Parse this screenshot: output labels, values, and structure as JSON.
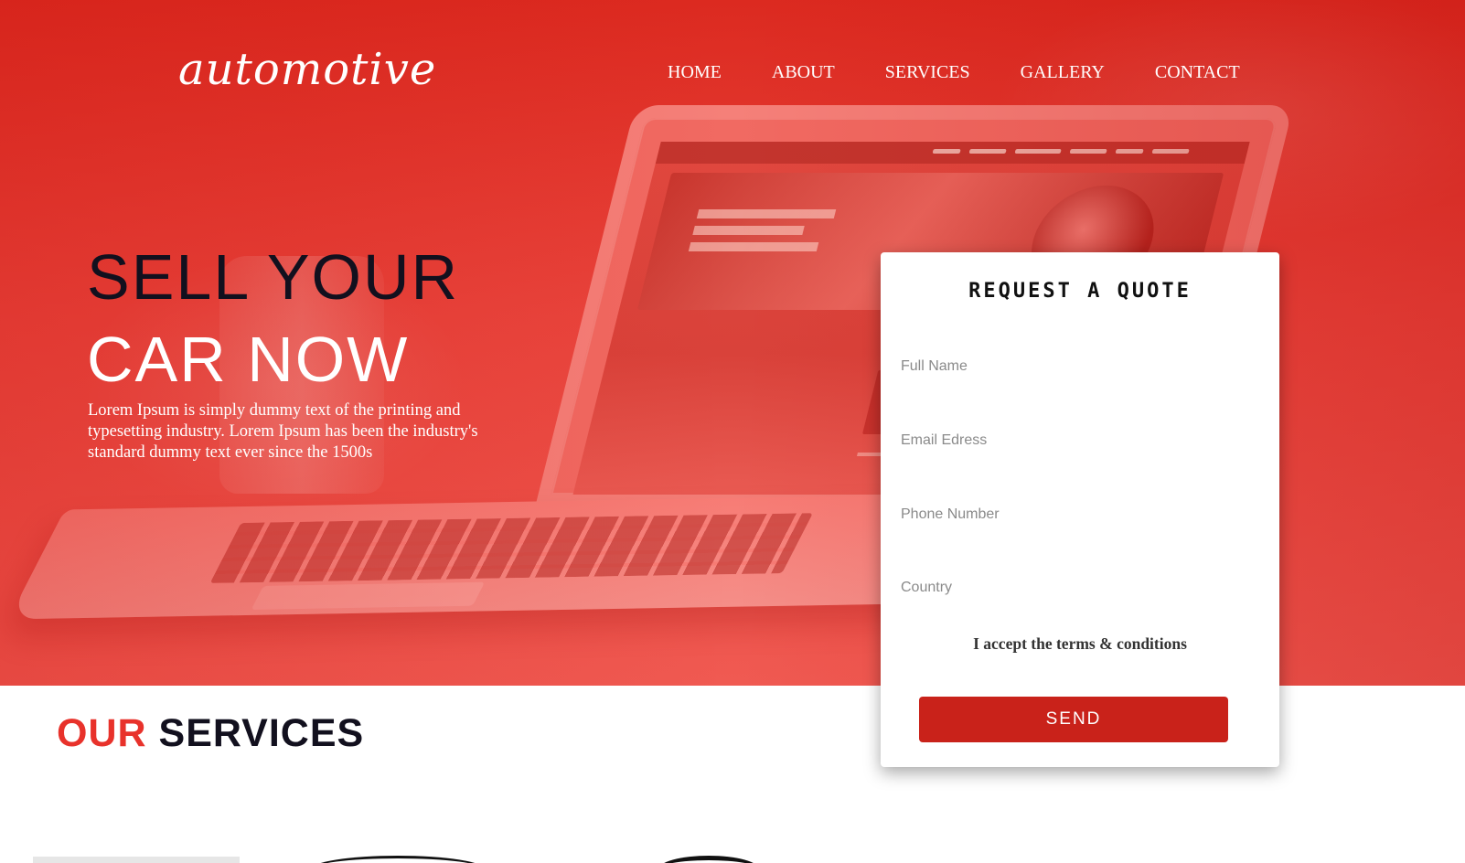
{
  "header": {
    "logo": "automotive",
    "nav": [
      "HOME",
      "ABOUT",
      "SERVICES",
      "GALLERY",
      "CONTACT"
    ]
  },
  "hero": {
    "title_line1": "SELL YOUR",
    "title_line2": "CAR NOW",
    "description": "Lorem Ipsum is simply dummy text of the printing and typesetting industry. Lorem Ipsum has been the industry's standard dummy text ever since the 1500s"
  },
  "quote_form": {
    "title": "REQUEST A QUOTE",
    "fields": [
      {
        "placeholder": "Full Name",
        "value": ""
      },
      {
        "placeholder": "Email Edress",
        "value": ""
      },
      {
        "placeholder": "Phone Number",
        "value": ""
      },
      {
        "placeholder": "Country",
        "value": ""
      }
    ],
    "terms": "I accept the terms & conditions",
    "send_label": "SEND"
  },
  "services": {
    "title_accent": "OUR",
    "title_rest": "SERVICES"
  },
  "colors": {
    "accent": "#e8322b",
    "button": "#c9221a",
    "hero_red": "#e9443c",
    "dark_text": "#12101e"
  }
}
